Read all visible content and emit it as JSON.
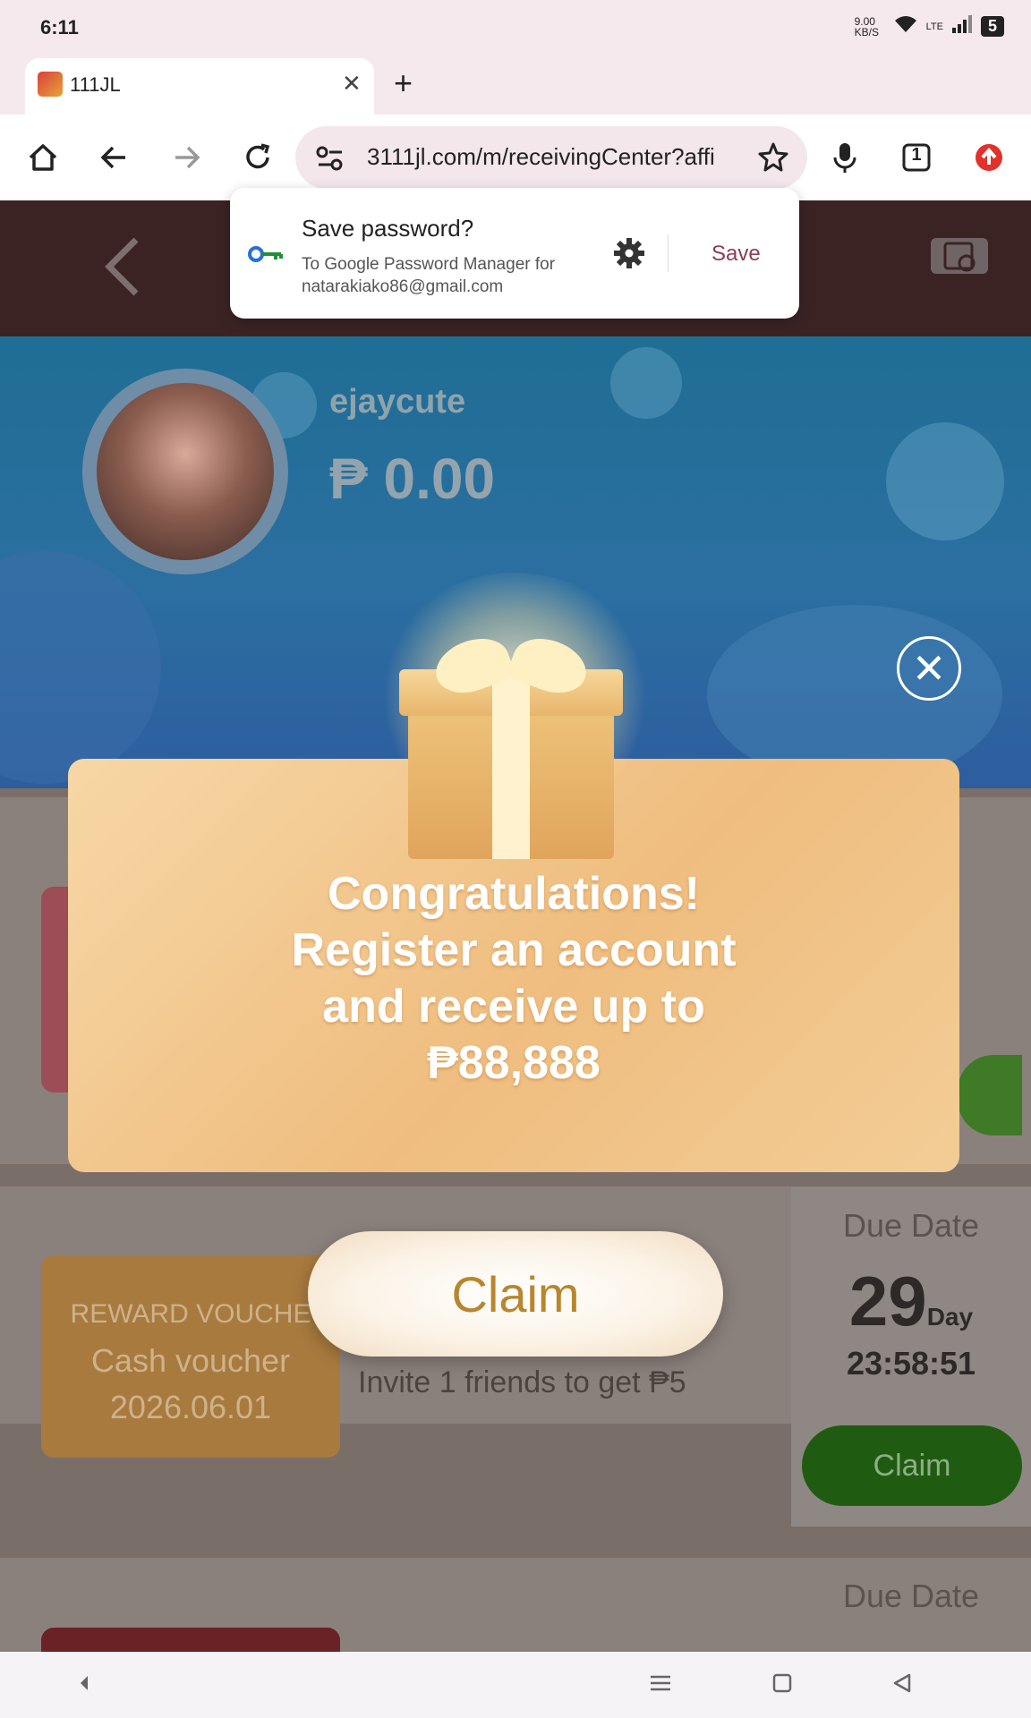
{
  "status_bar": {
    "time": "6:11",
    "speed": "9.00 KB/S",
    "network": "LTE",
    "battery": "5"
  },
  "browser": {
    "tab_title": "111JL",
    "url": "3111jl.com/m/receivingCenter?affi",
    "tab_count": "1"
  },
  "password_prompt": {
    "title": "Save password?",
    "subtitle": "To Google Password Manager for natarakiako86@gmail.com",
    "save_label": "Save"
  },
  "profile": {
    "username": "ejaycute",
    "balance": "₱ 0.00"
  },
  "background_cards": [
    {
      "label_lines": [
        "REWARD VOUCHE",
        "Cash voucher",
        "2026.06.01"
      ],
      "description": "Invite 1 friends to get ₱5",
      "due_label": "Due Date",
      "days": "29",
      "days_unit": "Day",
      "time_left": "23:58:51",
      "claim_label": "Claim"
    },
    {
      "due_label": "Due Date"
    }
  ],
  "modal": {
    "line1": "Congratulations!",
    "line2": "Register an account",
    "line3": "and receive up to",
    "amount": "₱88,888",
    "claim_label": "Claim"
  },
  "colors": {
    "modal_bg": "#efbd7f",
    "claim_text": "#b8862e",
    "claim_green": "#1f8a12",
    "header_bg": "#3b2324"
  }
}
